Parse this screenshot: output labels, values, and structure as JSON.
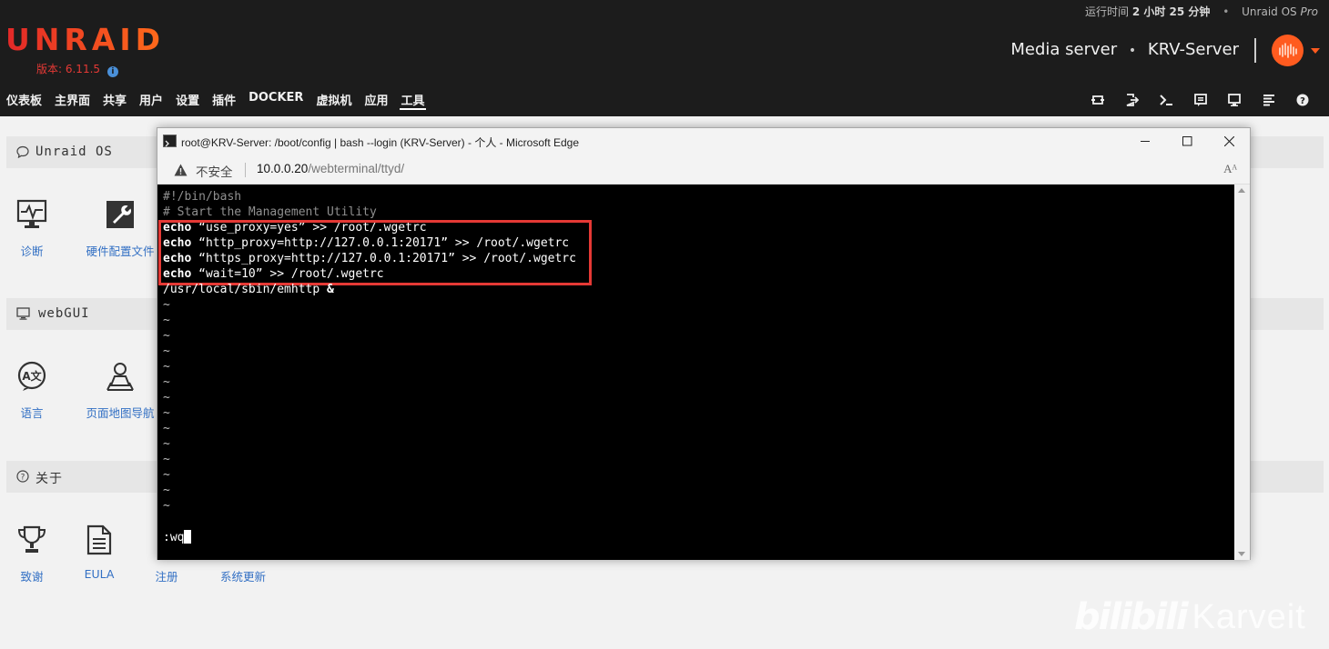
{
  "header": {
    "uptime_prefix": "运行时间",
    "uptime_value": "2 小时 25 分钟",
    "edition_name": "Unraid OS",
    "edition_tier": "Pro",
    "logo_text": "UNRAID",
    "version": "版本: 6.11.5",
    "server_description": "Media server",
    "server_name": "KRV-Server"
  },
  "nav": {
    "items": [
      {
        "label": "仪表板"
      },
      {
        "label": "主界面"
      },
      {
        "label": "共享"
      },
      {
        "label": "用户"
      },
      {
        "label": "设置"
      },
      {
        "label": "插件"
      },
      {
        "label": "DOCKER"
      },
      {
        "label": "虚拟机"
      },
      {
        "label": "应用"
      },
      {
        "label": "工具"
      }
    ],
    "active": "工具",
    "right_icons": [
      "switch-icon",
      "logout-icon",
      "terminal-icon",
      "feedback-icon",
      "monitor-icon",
      "log-icon",
      "help-icon"
    ]
  },
  "sections": [
    {
      "title": "Unraid OS",
      "icon": "speech-bubble-icon",
      "tiles": [
        {
          "label": "诊断",
          "icon": "diagnostics-icon"
        },
        {
          "label": "硬件配置文件",
          "icon": "wrench-icon"
        }
      ]
    },
    {
      "title": "webGUI",
      "icon": "desktop-icon",
      "tiles": [
        {
          "label": "语言",
          "icon": "language-icon"
        },
        {
          "label": "页面地图导航",
          "icon": "map-user-icon"
        }
      ]
    },
    {
      "title": "关于",
      "icon": "question-circle-icon",
      "tiles": [
        {
          "label": "致谢",
          "icon": "trophy-icon"
        },
        {
          "label": "EULA",
          "icon": "document-icon"
        },
        {
          "label": "注册",
          "icon": "register-icon"
        },
        {
          "label": "系统更新",
          "icon": "update-icon"
        }
      ]
    }
  ],
  "browser": {
    "title": "root@KRV-Server: /boot/config | bash --login (KRV-Server) - 个人 - Microsoft Edge",
    "security_label": "不安全",
    "url_host": "10.0.0.20",
    "url_path": "/webterminal/ttyd/",
    "read_aloud": "Aᴬ"
  },
  "terminal": {
    "shebang": "#!/bin/bash",
    "comment": "# Start the Management Utility",
    "echo_lines": [
      {
        "kw": "echo",
        "rest": " “use_proxy=yes” >> /root/.wgetrc"
      },
      {
        "kw": "echo",
        "rest": " “http_proxy=http://127.0.0.1:20171” >> /root/.wgetrc"
      },
      {
        "kw": "echo",
        "rest": " “https_proxy=http://127.0.0.1:20171” >> /root/.wgetrc"
      },
      {
        "kw": "echo",
        "rest": " “wait=10” >> /root/.wgetrc"
      }
    ],
    "emhttp_cmd": "/usr/local/sbin/emhttp",
    "emhttp_amp": " &",
    "tilde": "~",
    "tilde_count": 14,
    "command_line": ":wq"
  },
  "watermark": {
    "brand": "bilibili",
    "name": "Karveit"
  }
}
